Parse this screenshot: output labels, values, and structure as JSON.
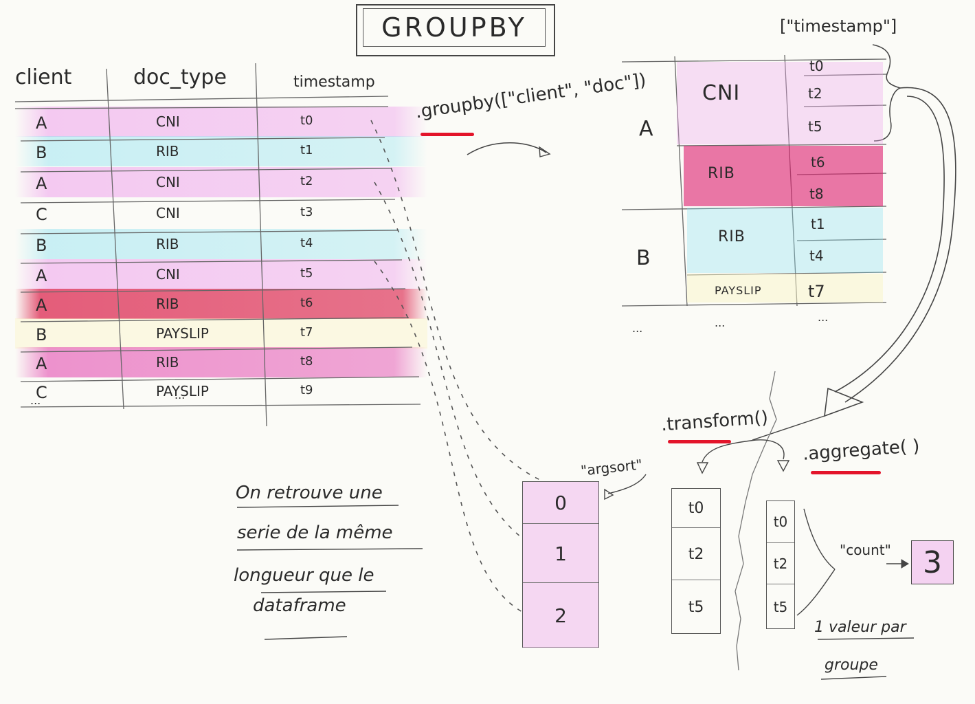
{
  "title": "GROUPBY",
  "source_table": {
    "headers": [
      "client",
      "doc_type",
      "timestamp"
    ],
    "rows": [
      {
        "client": "A",
        "doc": "CNI",
        "ts": "t0",
        "hl": "pink"
      },
      {
        "client": "B",
        "doc": "RIB",
        "ts": "t1",
        "hl": "cyan"
      },
      {
        "client": "A",
        "doc": "CNI",
        "ts": "t2",
        "hl": "pink"
      },
      {
        "client": "C",
        "doc": "CNI",
        "ts": "t3",
        "hl": "none"
      },
      {
        "client": "B",
        "doc": "RIB",
        "ts": "t4",
        "hl": "cyan"
      },
      {
        "client": "A",
        "doc": "CNI",
        "ts": "t5",
        "hl": "pink"
      },
      {
        "client": "A",
        "doc": "RIB",
        "ts": "t6",
        "hl": "red"
      },
      {
        "client": "B",
        "doc": "PAYSLIP",
        "ts": "t7",
        "hl": "yellow"
      },
      {
        "client": "A",
        "doc": "RIB",
        "ts": "t8",
        "hl": "magenta"
      },
      {
        "client": "C",
        "doc": "PAYSLIP",
        "ts": "t9",
        "hl": "none"
      }
    ],
    "ellipsis": [
      "...",
      "..."
    ]
  },
  "groupby_call": ".groupby([\"client\", \"doc\"])",
  "timestamp_selector": "[\"timestamp\"]",
  "grouped_table": {
    "group_A": "A",
    "group_B": "B",
    "A_CNI": {
      "doc": "CNI",
      "ts": [
        "t0",
        "t2",
        "t5"
      ]
    },
    "A_RIB": {
      "doc": "RIB",
      "ts": [
        "t6",
        "t8"
      ]
    },
    "B_RIB": {
      "doc": "RIB",
      "ts": [
        "t1",
        "t4"
      ]
    },
    "B_PAYSLIP": {
      "doc": "PAYSLIP",
      "ts": [
        "t7"
      ]
    },
    "ellipsis": [
      "...",
      "...",
      "..."
    ]
  },
  "transform_call": ".transform()",
  "aggregate_call": ".aggregate( )",
  "argsort_label": "\"argsort\"",
  "count_label": "\"count\"",
  "argsort_values": [
    "0",
    "1",
    "2"
  ],
  "transform_values": [
    "t0",
    "t2",
    "t5"
  ],
  "aggregate_values": [
    "t0",
    "t2",
    "t5"
  ],
  "count_result": "3",
  "note_left": [
    "On retrouve une",
    "serie de la même",
    "longueur que le",
    "dataframe"
  ],
  "note_right": [
    "1 valeur par",
    "groupe"
  ],
  "colors": {
    "pink": "#eeaaec",
    "cyan": "#8ce1f0",
    "red": "#dc2850",
    "magenta": "#e13caa",
    "underline": "#e3142a"
  }
}
